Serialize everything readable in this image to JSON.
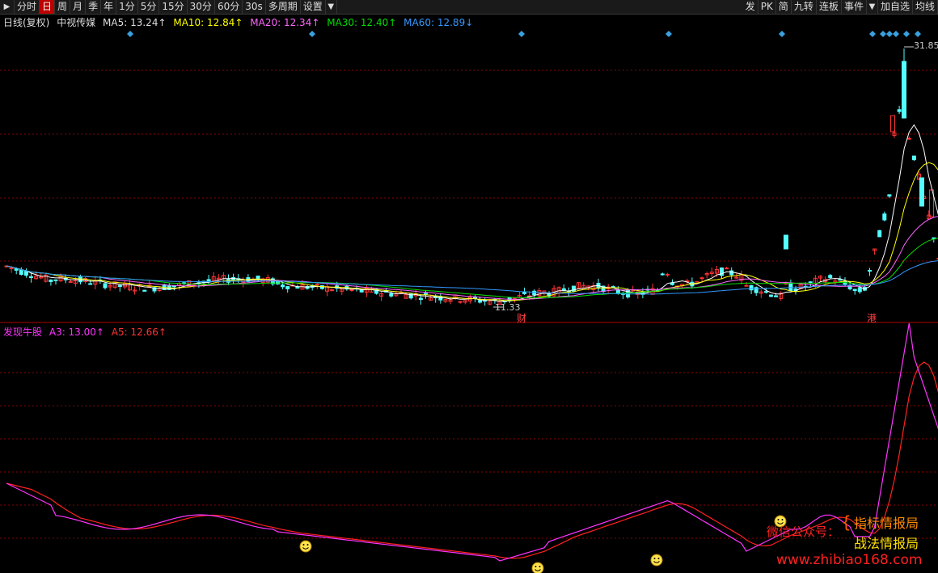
{
  "toolbar": {
    "items": [
      "分时",
      "日",
      "周",
      "月",
      "季",
      "年",
      "1分",
      "5分",
      "15分",
      "30分",
      "60分",
      "30s",
      "多周期",
      "设置"
    ],
    "active_index": 1,
    "right_items": [
      "发",
      "PK",
      "简",
      "九转",
      "连板",
      "事件",
      "加自选",
      "均线"
    ]
  },
  "main_legend": {
    "chart_name": "日线(复权)",
    "stock_name": "中视传媒",
    "ma5": "MA5: 13.24↑",
    "ma10": "MA10: 12.84↑",
    "ma20": "MA20: 12.34↑",
    "ma30": "MA30: 12.40↑",
    "ma60": "MA60: 12.89↓"
  },
  "main_chart": {
    "high_label": "31.85",
    "low_label": "11.33",
    "marker_cai": "财",
    "marker_gang": "港"
  },
  "indicator_legend": {
    "name": "发现牛股",
    "a3": "A3: 13.00↑",
    "a5": "A5: 12.66↑"
  },
  "watermark": {
    "wechat": "微信公众号：",
    "line1": "指标情报局",
    "line2": "战法情报局",
    "url": "www.zhibiao168.com"
  },
  "colors": {
    "up": "#ff3333",
    "down": "#54ffff",
    "ma5": "#ffffff",
    "ma10": "#ffff00",
    "ma20": "#ff66ff",
    "ma30": "#00dd00",
    "ma60": "#3399ff",
    "a3": "#ff33ff",
    "a5": "#ff2020",
    "grid": "#8b0000"
  },
  "chart_data": [
    {
      "type": "candlestick",
      "title": "中视传媒 日线(复权)",
      "y_high": 31.85,
      "y_low": 11.33,
      "series": [
        {
          "name": "MA5",
          "last": 13.24
        },
        {
          "name": "MA10",
          "last": 12.84
        },
        {
          "name": "MA20",
          "last": 12.34
        },
        {
          "name": "MA30",
          "last": 12.4
        },
        {
          "name": "MA60",
          "last": 12.89
        }
      ]
    },
    {
      "type": "line",
      "title": "发现牛股",
      "series": [
        {
          "name": "A3",
          "last": 13.0
        },
        {
          "name": "A5",
          "last": 12.66
        }
      ]
    }
  ]
}
